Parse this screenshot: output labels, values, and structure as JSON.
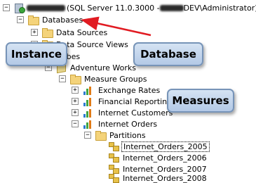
{
  "tree": {
    "server": {
      "suffix": "(SQL Server 11.0.3000 - ",
      "user_suffix": "DEV\\Administrator)"
    },
    "databases": "Databases",
    "data_sources": "Data Sources",
    "data_source_views": "Data Source Views",
    "cubes": "Cubes",
    "adventure_works": "Adventure Works",
    "measure_groups": "Measure Groups",
    "exchange_rates": "Exchange Rates",
    "financial_reporting": "Financial Reporting",
    "internet_customers": "Internet Customers",
    "internet_orders": "Internet Orders",
    "partitions": "Partitions",
    "partition_items": [
      "Internet_Orders_2005",
      "Internet_Orders_2006",
      "Internet_Orders_2007",
      "Internet_Orders_2008"
    ]
  },
  "callouts": {
    "instance": "Instance",
    "database": "Database",
    "measures": "Measures"
  },
  "colors": {
    "callout_fill": "#c7d8ee",
    "callout_border": "#7794b8",
    "arrow": "#e11b22"
  },
  "icons": {
    "server": "server-icon",
    "folder": "folder-icon",
    "cube": "cube-icon",
    "measure_group": "bar-chart-icon",
    "partition": "partition-icon"
  }
}
